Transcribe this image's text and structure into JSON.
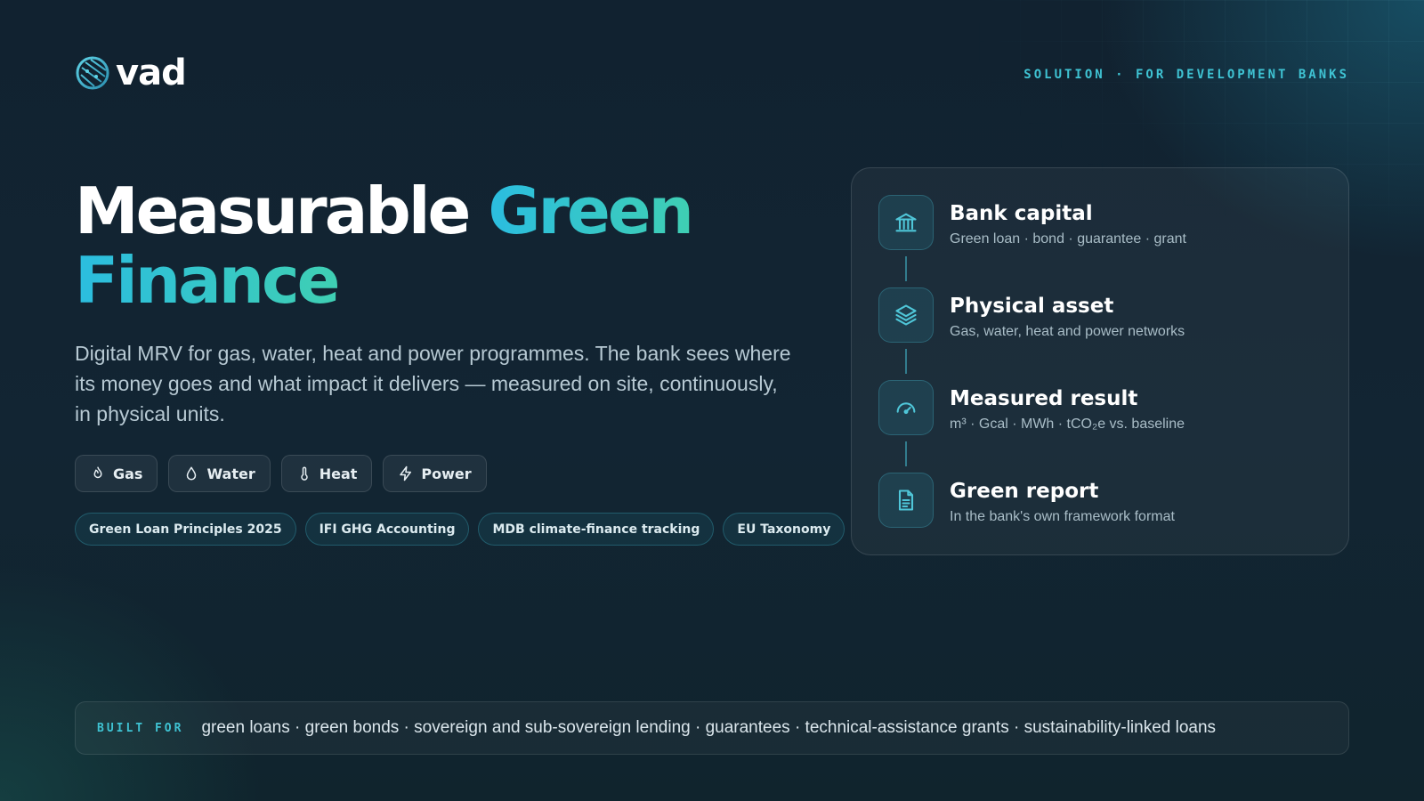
{
  "brand": {
    "name": "vad",
    "logo_icon": "globe-mesh-icon"
  },
  "eyebrow": "SOLUTION · FOR DEVELOPMENT BANKS",
  "headline": {
    "white": "Measurable",
    "accent_line1": "Green",
    "accent_line2": "Finance"
  },
  "lead": "Digital MRV for gas, water, heat and power programmes. The bank sees where its money goes and what impact it delivers — measured on site, continuously, in physical units.",
  "utilities": [
    {
      "label": "Gas",
      "icon": "flame-icon"
    },
    {
      "label": "Water",
      "icon": "droplet-icon"
    },
    {
      "label": "Heat",
      "icon": "thermometer-icon"
    },
    {
      "label": "Power",
      "icon": "bolt-icon"
    }
  ],
  "frameworks": [
    "Green Loan Principles 2025",
    "IFI GHG Accounting",
    "MDB climate-finance tracking",
    "EU Taxonomy"
  ],
  "flow": [
    {
      "title": "Bank capital",
      "subtitle": "Green loan · bond · guarantee · grant",
      "icon": "bank-icon"
    },
    {
      "title": "Physical asset",
      "subtitle": "Gas, water, heat and power networks",
      "icon": "layers-icon"
    },
    {
      "title": "Measured result",
      "subtitle": "m³ · Gcal · MWh · tCO₂e vs. baseline",
      "icon": "gauge-icon"
    },
    {
      "title": "Green report",
      "subtitle": "In the bank's own framework format",
      "icon": "document-icon"
    }
  ],
  "built_for": {
    "label": "BUILT FOR",
    "text": "green loans · green bonds · sovereign and sub-sovereign lending · guarantees · technical-assistance grants · sustainability-linked loans"
  },
  "colors": {
    "accent_cyan": "#3fc3d3",
    "accent_green": "#3fcfb3",
    "background": "#11222f"
  }
}
